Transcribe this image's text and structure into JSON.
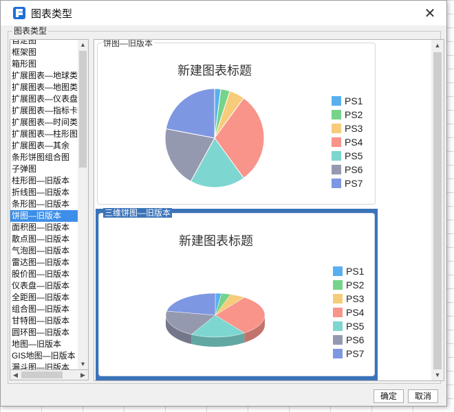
{
  "dialog": {
    "title": "图表类型",
    "group_label": "图表类型",
    "ok_label": "确定",
    "cancel_label": "取消"
  },
  "chart_types": [
    "自定图",
    "框架图",
    "箱形图",
    "扩展图表—地球类",
    "扩展图表—地图类",
    "扩展图表—仪表盘",
    "扩展图表—指标卡",
    "扩展图表—时间类",
    "扩展图表—柱形图",
    "扩展图表—其余",
    "条形饼图组合图",
    "子弹图",
    "柱形图—旧版本",
    "折线图—旧版本",
    "条形图—旧版本",
    "饼图—旧版本",
    "面积图—旧版本",
    "散点图—旧版本",
    "气泡图—旧版本",
    "雷达图—旧版本",
    "股价图—旧版本",
    "仪表盘—旧版本",
    "全距图—旧版本",
    "组合图—旧版本",
    "甘特图—旧版本",
    "圆环图—旧版本",
    "地图—旧版本",
    "GIS地图—旧版本",
    "漏斗图—旧版本"
  ],
  "selected_index": 15,
  "preview": {
    "card1_label": "饼图—旧版本",
    "card2_label": "三维饼图—旧版本"
  },
  "chart_data": [
    {
      "type": "pie",
      "title": "新建图表标题",
      "series": [
        {
          "name": "PS1",
          "value": 2,
          "color": "#5ab0ee"
        },
        {
          "name": "PS2",
          "value": 3,
          "color": "#76d38a"
        },
        {
          "name": "PS3",
          "value": 5,
          "color": "#f6cc7a"
        },
        {
          "name": "PS4",
          "value": 30,
          "color": "#f8948a"
        },
        {
          "name": "PS5",
          "value": 18,
          "color": "#7dd6cf"
        },
        {
          "name": "PS6",
          "value": 20,
          "color": "#9599b0"
        },
        {
          "name": "PS7",
          "value": 22,
          "color": "#7e97e2"
        }
      ],
      "legend": "right"
    },
    {
      "type": "pie",
      "title": "新建图表标题",
      "three_d": true,
      "series": [
        {
          "name": "PS1",
          "value": 2,
          "color": "#5ab0ee"
        },
        {
          "name": "PS2",
          "value": 3,
          "color": "#76d38a"
        },
        {
          "name": "PS3",
          "value": 5,
          "color": "#f6cc7a"
        },
        {
          "name": "PS4",
          "value": 30,
          "color": "#f8948a"
        },
        {
          "name": "PS5",
          "value": 18,
          "color": "#7dd6cf"
        },
        {
          "name": "PS6",
          "value": 20,
          "color": "#9599b0"
        },
        {
          "name": "PS7",
          "value": 22,
          "color": "#7e97e2"
        }
      ],
      "legend": "right"
    }
  ]
}
